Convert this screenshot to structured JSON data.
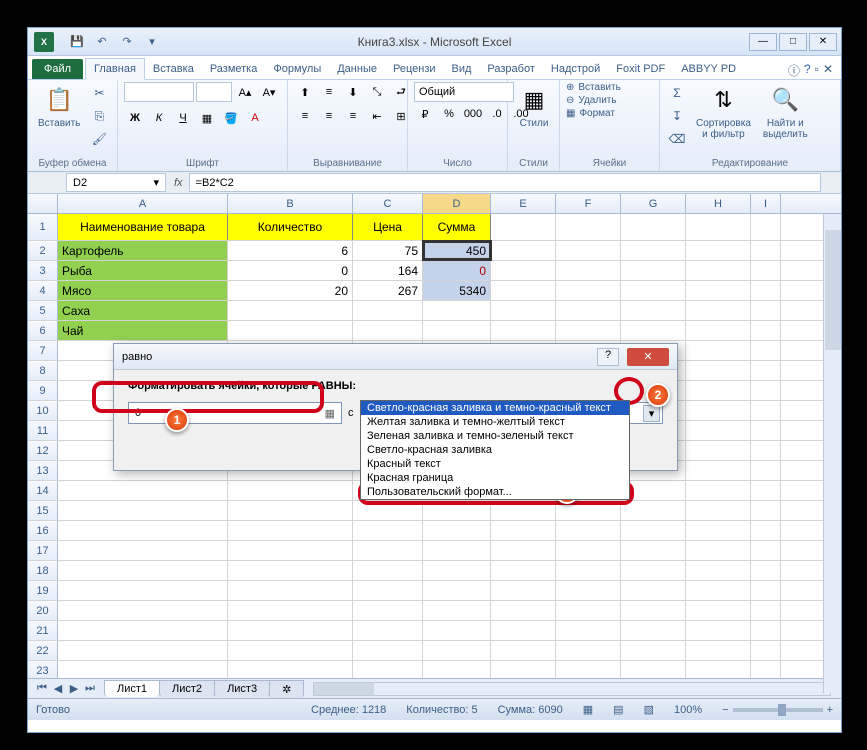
{
  "window": {
    "title": "Книга3.xlsx - Microsoft Excel",
    "app_icon_text": "X"
  },
  "qat": [
    "save-icon",
    "undo-icon",
    "redo-icon"
  ],
  "ribbon": {
    "file_tab": "Файл",
    "tabs": [
      "Главная",
      "Вставка",
      "Разметка",
      "Формулы",
      "Данные",
      "Рецензи",
      "Вид",
      "Разработ",
      "Надстрой",
      "Foxit PDF",
      "ABBYY PD"
    ],
    "active_tab": 0,
    "groups": {
      "clipboard": {
        "label": "Буфер обмена",
        "paste": "Вставить"
      },
      "font": {
        "label": "Шрифт",
        "name": "",
        "size": ""
      },
      "align": {
        "label": "Выравнивание"
      },
      "number": {
        "label": "Число",
        "format": "Общий"
      },
      "styles": {
        "label": "Стили",
        "btn": "Стили"
      },
      "cells": {
        "label": "Ячейки",
        "insert": "Вставить",
        "delete": "Удалить",
        "format": "Формат"
      },
      "editing": {
        "label": "Редактирование",
        "sort": "Сортировка\nи фильтр",
        "find": "Найти и\nвыделить"
      }
    }
  },
  "formula_bar": {
    "name_box": "D2",
    "formula": "=B2*C2"
  },
  "grid": {
    "columns": [
      "A",
      "B",
      "C",
      "D",
      "E",
      "F",
      "G",
      "H",
      "I"
    ],
    "selected_col": "D",
    "headers": [
      "Наименование товара",
      "Количество",
      "Цена",
      "Сумма"
    ],
    "rows": [
      {
        "name": "Картофель",
        "qty": "6",
        "price": "75",
        "sum": "450"
      },
      {
        "name": "Рыба",
        "qty": "0",
        "price": "164",
        "sum": "0"
      },
      {
        "name": "Мясо",
        "qty": "20",
        "price": "267",
        "sum": "5340"
      },
      {
        "name": "Саха",
        "qty": "",
        "price": "",
        "sum": ""
      },
      {
        "name": "Чай",
        "qty": "",
        "price": "",
        "sum": ""
      }
    ],
    "visible_row_numbers": [
      "1",
      "2",
      "3",
      "4",
      "5",
      "6",
      "7",
      "8",
      "9",
      "10",
      "11",
      "12",
      "13",
      "14",
      "15",
      "16",
      "17",
      "18",
      "19",
      "20",
      "21",
      "22",
      "23"
    ]
  },
  "sheets": {
    "tabs": [
      "Лист1",
      "Лист2",
      "Лист3"
    ],
    "active": 0
  },
  "statusbar": {
    "ready": "Готово",
    "avg": "Среднее: 1218",
    "count": "Количество: 5",
    "sum": "Сумма: 6090",
    "zoom": "100%"
  },
  "dialog": {
    "title": "равно",
    "label": "Форматировать ячейки, которые РАВНЫ:",
    "value": "0",
    "separator": "с",
    "selected_format": "Светло-красная заливка и темно-красный текст",
    "options": [
      "Светло-красная заливка и темно-красный текст",
      "Желтая заливка и темно-желтый текст",
      "Зеленая заливка и темно-зеленый текст",
      "Светло-красная заливка",
      "Красный текст",
      "Красная граница",
      "Пользовательский формат..."
    ]
  },
  "callouts": {
    "b1": "1",
    "b2": "2",
    "b3": "3"
  }
}
